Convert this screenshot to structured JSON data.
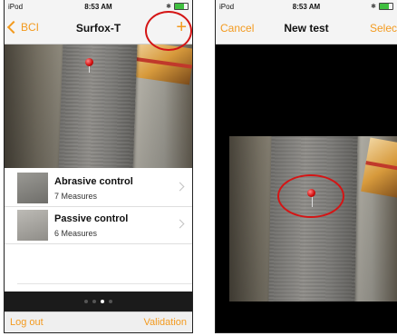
{
  "left_screen": {
    "status": {
      "carrier": "iPod",
      "time": "8:53 AM"
    },
    "nav": {
      "back_label": "BCI",
      "title": "Surfox-T",
      "add_symbol": "+"
    },
    "list": [
      {
        "title": "Abrasive control",
        "subtitle": "7 Measures"
      },
      {
        "title": "Passive control",
        "subtitle": "6 Measures"
      }
    ],
    "pager": {
      "count": 4,
      "active_index": 2
    },
    "toolbar": {
      "left": "Log out",
      "right": "Validation"
    }
  },
  "right_screen": {
    "status": {
      "carrier": "iPod",
      "time": "8:53 AM"
    },
    "nav": {
      "cancel_label": "Cancel",
      "title": "New test",
      "select_label": "Selec"
    }
  },
  "colors": {
    "accent": "#f39a1e",
    "annotation": "#d41515"
  }
}
